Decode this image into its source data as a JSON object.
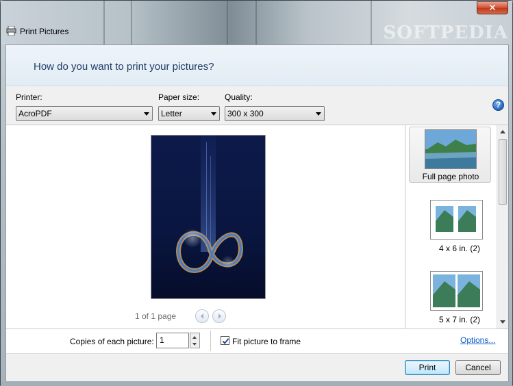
{
  "window": {
    "title": "Print Pictures",
    "close_label": "✕",
    "watermark": "SOFTPEDIA"
  },
  "header": {
    "question": "How do you want to print your pictures?"
  },
  "settings": {
    "printer_label": "Printer:",
    "printer_value": "AcroPDF",
    "paper_label": "Paper size:",
    "paper_value": "Letter",
    "quality_label": "Quality:",
    "quality_value": "300 x 300",
    "help_label": "?"
  },
  "preview": {
    "page_count": "1 of 1 page"
  },
  "layouts": {
    "items": [
      {
        "label": "Full page photo",
        "selected": true
      },
      {
        "label": "4 x 6 in. (2)",
        "selected": false
      },
      {
        "label": "5 x 7 in. (2)",
        "selected": false
      }
    ]
  },
  "copies": {
    "label": "Copies of each picture:",
    "value": "1",
    "fit_label": "Fit picture to frame",
    "fit_checked": true,
    "options_link": "Options..."
  },
  "buttons": {
    "print": "Print",
    "cancel": "Cancel"
  },
  "colors": {
    "header_text": "#1e3a62",
    "link": "#0b5cc4",
    "close_red": "#c03a1c"
  }
}
